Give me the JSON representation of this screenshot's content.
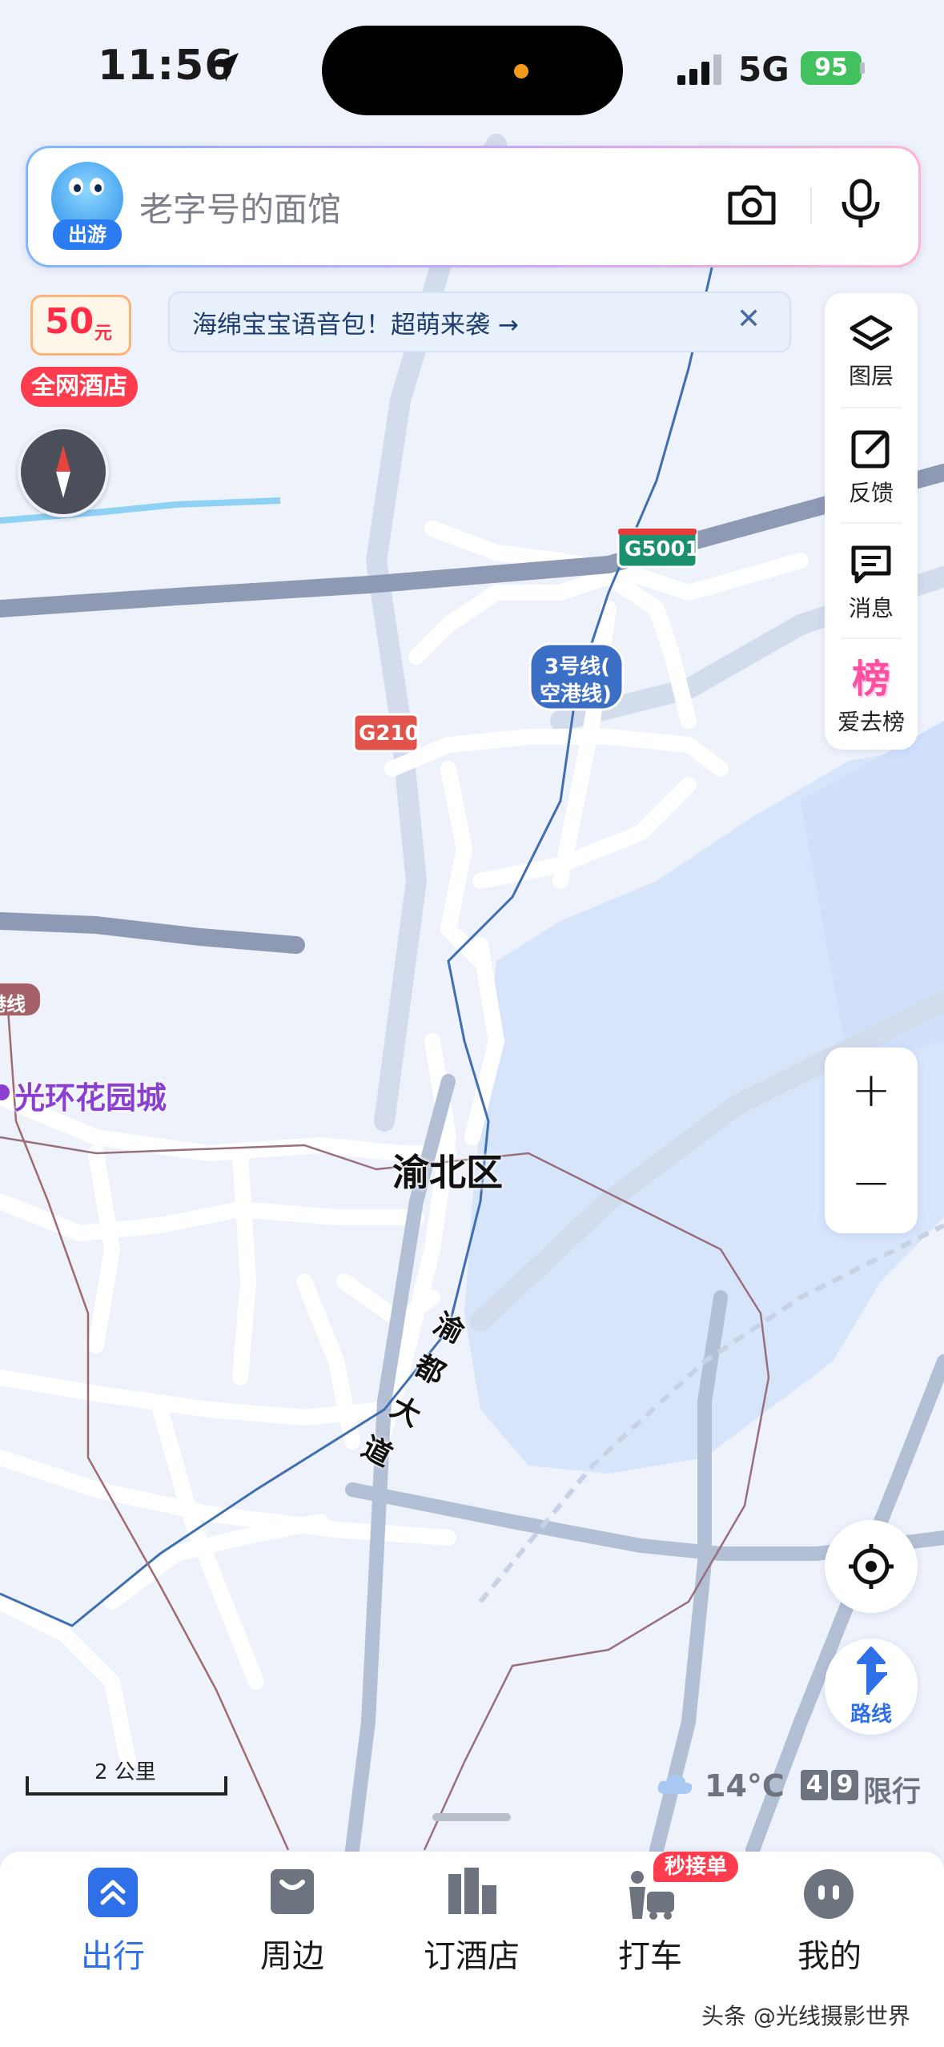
{
  "status_bar": {
    "time": "11:56",
    "network": "5G",
    "battery": "95"
  },
  "search": {
    "mascot_badge": "出游",
    "placeholder": "老字号的面馆"
  },
  "promo": {
    "amount": "50",
    "unit": "元",
    "label": "全网酒店"
  },
  "banner": {
    "text": "海绵宝宝语音包！超萌来袭 →",
    "close": "✕"
  },
  "toolbar": {
    "items": [
      {
        "label": "图层",
        "icon": "layers-icon"
      },
      {
        "label": "反馈",
        "icon": "feedback-icon"
      },
      {
        "label": "消息",
        "icon": "message-icon"
      },
      {
        "label": "爱去榜",
        "icon": "ranking-icon",
        "icon_text": "榜"
      }
    ]
  },
  "zoom": {
    "in": "+",
    "out": "−"
  },
  "map": {
    "labels": {
      "g5001": "G5001",
      "g210": "G210",
      "metro3_line1": "3号线(",
      "metro3_line2": "空港线)",
      "district": "渝北区",
      "garden": "光环花园城",
      "road_c1": "渝",
      "road_c2": "都",
      "road_c3": "大",
      "road_c4": "道",
      "edge_line": "港线"
    }
  },
  "route": {
    "label": "路线"
  },
  "scale": {
    "label": "2 公里"
  },
  "weather": {
    "temp": "14°C",
    "plate1": "4",
    "plate2": "9",
    "limit": "限行"
  },
  "tabs": [
    {
      "label": "出行",
      "active": true
    },
    {
      "label": "周边",
      "active": false
    },
    {
      "label": "订酒店",
      "active": false
    },
    {
      "label": "打车",
      "active": false,
      "badge": "秒接单"
    },
    {
      "label": "我的",
      "active": false
    }
  ],
  "watermark": "头条 @光线摄影世界",
  "colors": {
    "accent": "#2f6fe8",
    "map_bg": "#eef2fb",
    "water": "#d8e7fb",
    "highway": "#8e9ab3",
    "road": "#ffffff",
    "metro_label": "#3b6fc6",
    "garden_label": "#8a3fd1"
  }
}
